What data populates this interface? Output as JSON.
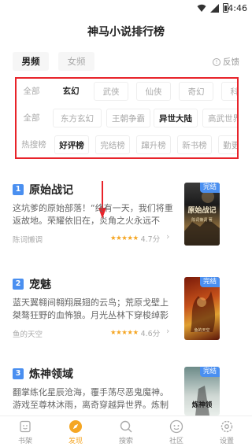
{
  "status_bar": {
    "time": "4:46"
  },
  "page_title": "神马小说排行榜",
  "gender_tabs": [
    "男频",
    "女频"
  ],
  "feedback_label": "反馈",
  "filters": {
    "row1": [
      "全部",
      "玄幻",
      "武侠",
      "仙侠",
      "奇幻",
      "科幻"
    ],
    "row2": [
      "全部",
      "东方玄幻",
      "王朝争霸",
      "异世大陆",
      "高武世界"
    ],
    "row3": [
      "热搜榜",
      "好评榜",
      "完结榜",
      "蹿升榜",
      "新书榜",
      "勤更榜"
    ],
    "selected": {
      "row1": "玄幻",
      "row2": "异世大陆",
      "row3": "好评榜"
    }
  },
  "books": [
    {
      "rank": "1",
      "title": "原始战记",
      "description": "这坑爹的原始部落！“终有一天，我们将重返故地。荣耀依旧在，炎角之火永远不灭。”心潮...",
      "author": "陈词懒调",
      "rating": "4.7分",
      "tag": "完结",
      "cover_text": "原始战记",
      "cover_subtext": "陈词懒调 著"
    },
    {
      "rank": "2",
      "title": "宠魅",
      "description": "蓝天翼翱间翱翔展翅的云鸟；荒原戈壁上桀骜狂野的血怖狼。月光丛林下穿梭绰影的夜梦...",
      "author": "鱼的天空",
      "rating": "4.6分",
      "tag": "完结",
      "cover_text": "",
      "cover_subtext": "鱼的天空"
    },
    {
      "rank": "3",
      "title": "炼神领域",
      "description": "翻掌练化星辰沧海，覆手荡尽恶鬼魔神。游戏至尊林沐雨，离奇穿越异世界。炼制圣丹神...",
      "author": "",
      "rating": "",
      "tag": "完结",
      "cover_text": "炼神领",
      "cover_subtext": ""
    }
  ],
  "tab_bar": [
    {
      "label": "书架",
      "icon": "bookshelf-icon"
    },
    {
      "label": "发现",
      "icon": "discover-icon"
    },
    {
      "label": "搜索",
      "icon": "search-icon"
    },
    {
      "label": "社区",
      "icon": "community-icon"
    },
    {
      "label": "设置",
      "icon": "settings-icon"
    }
  ],
  "colors": {
    "accent_blue": "#4a8ff0",
    "annotation_red": "#e8232a",
    "active_tab": "#f5a623"
  }
}
